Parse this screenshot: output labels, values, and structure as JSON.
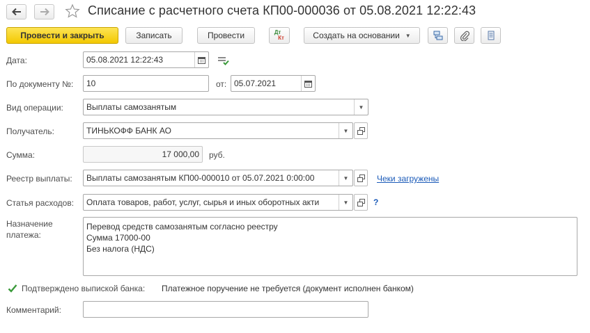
{
  "window": {
    "title": "Списание с расчетного счета КП00-000036 от 05.08.2021 12:22:43"
  },
  "icons": {
    "back": "arrow-left-icon",
    "forward": "arrow-right-icon",
    "favorite": "star-icon",
    "calendar": "calendar-icon",
    "dropdown": "chevron-down-icon",
    "open": "open-window-icon"
  },
  "toolbar": {
    "post_close": "Провести и закрыть",
    "save": "Записать",
    "post": "Провести",
    "dt_kt_top": "Дт",
    "dt_kt_bottom": "Кт",
    "create_based": "Создать на основании"
  },
  "form": {
    "date": {
      "label": "Дата:",
      "value": "05.08.2021 12:22:43"
    },
    "by_doc": {
      "label": "По документу №:",
      "value": "10",
      "from_label": "от:",
      "from_value": "05.07.2021"
    },
    "operation": {
      "label": "Вид операции:",
      "value": "Выплаты самозанятым"
    },
    "recipient": {
      "label": "Получатель:",
      "value": "ТИНЬКОФФ БАНК АО"
    },
    "amount": {
      "label": "Сумма:",
      "value": "17 000,00",
      "currency": "руб."
    },
    "registry": {
      "label": "Реестр выплаты:",
      "value": "Выплаты самозанятым КП00-000010 от 05.07.2021 0:00:00",
      "link": "Чеки загружены"
    },
    "expense": {
      "label": "Статья расходов:",
      "value": "Оплата товаров, работ, услуг, сырья и иных оборотных акти",
      "help": "?"
    },
    "purpose": {
      "label_line1": "Назначение",
      "label_line2": "платежа:",
      "lines": [
        "Перевод средств самозанятым согласно реестру",
        "Сумма 17000-00",
        "Без налога (НДС)"
      ]
    },
    "confirmed": {
      "label": "Подтверждено выпиской банка:",
      "checked": true,
      "note": "Платежное поручение не требуется (документ исполнен банком)"
    },
    "comment": {
      "label": "Комментарий:",
      "value": ""
    }
  },
  "colors": {
    "primary_button": "#f5cd0a",
    "link": "#1a5ab8",
    "check": "#3a9a3a",
    "dt_kt": "#d04030"
  }
}
